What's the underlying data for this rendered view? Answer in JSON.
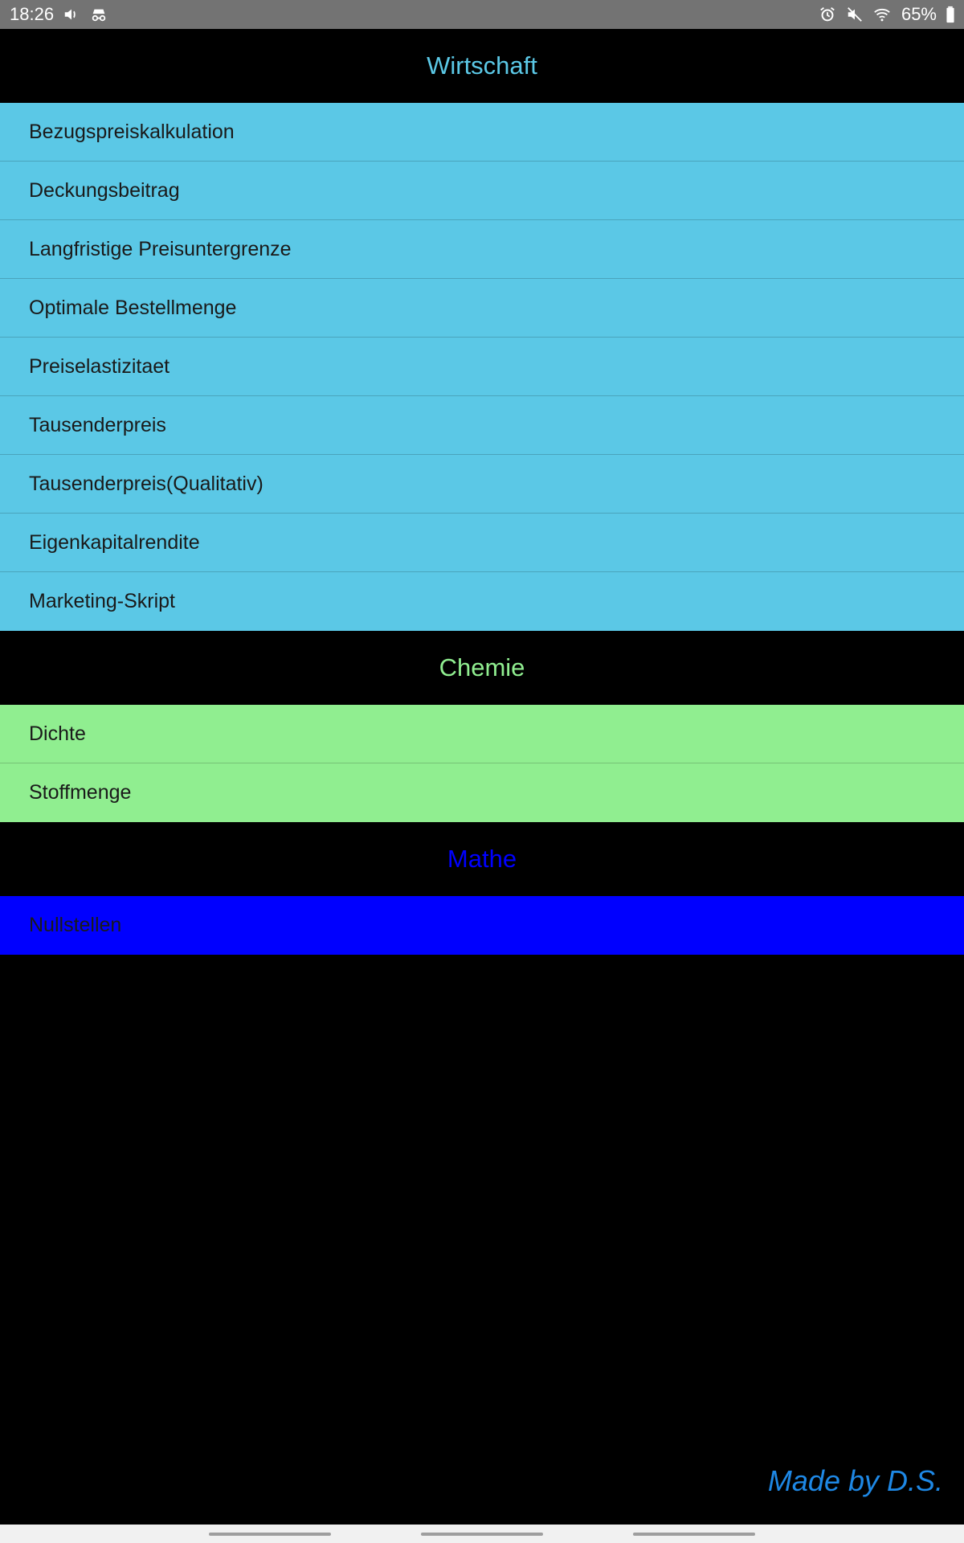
{
  "status_bar": {
    "time": "18:26",
    "battery": "65%",
    "icons_left": [
      "volume-icon",
      "incognito-icon"
    ],
    "icons_right": [
      "alarm-icon",
      "mute-icon",
      "wifi-icon",
      "battery-icon"
    ]
  },
  "sections": [
    {
      "title": "Wirtschaft",
      "title_color": "#5bc8e6",
      "item_bg": "#5bc8e6",
      "items": [
        "Bezugspreiskalkulation",
        "Deckungsbeitrag",
        "Langfristige Preisuntergrenze",
        "Optimale Bestellmenge",
        "Preiselastizitaet",
        "Tausenderpreis",
        "Tausenderpreis(Qualitativ)",
        "Eigenkapitalrendite",
        "Marketing-Skript"
      ]
    },
    {
      "title": "Chemie",
      "title_color": "#90ee90",
      "item_bg": "#90ee90",
      "items": [
        "Dichte",
        "Stoffmenge"
      ]
    },
    {
      "title": "Mathe",
      "title_color": "#0000ff",
      "item_bg": "#0000ff",
      "items": [
        "Nullstellen"
      ]
    }
  ],
  "footer": {
    "credit": "Made by D.S.",
    "color": "#1e88e5"
  }
}
